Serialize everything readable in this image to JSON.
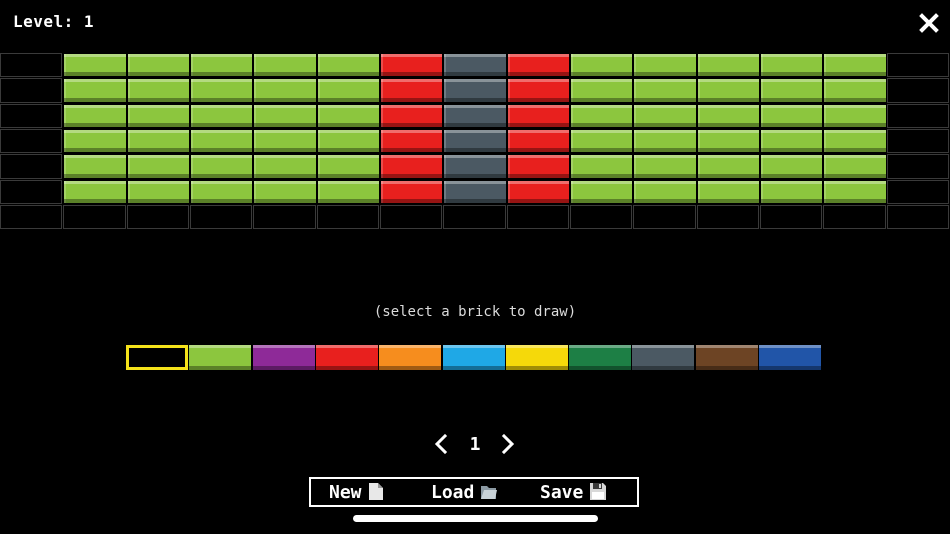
{
  "header": {
    "level_label": "Level: 1"
  },
  "grid": {
    "columns": 15,
    "rows": 7,
    "bricks": [
      [
        "empty",
        "green",
        "green",
        "green",
        "green",
        "green",
        "red",
        "gray",
        "red",
        "green",
        "green",
        "green",
        "green",
        "green",
        "empty"
      ],
      [
        "empty",
        "green",
        "green",
        "green",
        "green",
        "green",
        "red",
        "gray",
        "red",
        "green",
        "green",
        "green",
        "green",
        "green",
        "empty"
      ],
      [
        "empty",
        "green",
        "green",
        "green",
        "green",
        "green",
        "red",
        "gray",
        "red",
        "green",
        "green",
        "green",
        "green",
        "green",
        "empty"
      ],
      [
        "empty",
        "green",
        "green",
        "green",
        "green",
        "green",
        "red",
        "gray",
        "red",
        "green",
        "green",
        "green",
        "green",
        "green",
        "empty"
      ],
      [
        "empty",
        "green",
        "green",
        "green",
        "green",
        "green",
        "red",
        "gray",
        "red",
        "green",
        "green",
        "green",
        "green",
        "green",
        "empty"
      ],
      [
        "empty",
        "green",
        "green",
        "green",
        "green",
        "green",
        "red",
        "gray",
        "red",
        "green",
        "green",
        "green",
        "green",
        "green",
        "empty"
      ],
      [
        "empty",
        "empty",
        "empty",
        "empty",
        "empty",
        "empty",
        "empty",
        "empty",
        "empty",
        "empty",
        "empty",
        "empty",
        "empty",
        "empty",
        "empty"
      ]
    ]
  },
  "colors": {
    "green": "#8cc63e",
    "red": "#e8201e",
    "gray": "#4b5963",
    "purple": "#8e2a98",
    "orange": "#f68d1e",
    "cyan": "#1fa8e6",
    "yellow": "#f5d90a",
    "darkgreen": "#1d7f45",
    "brown": "#6d4424",
    "blue": "#2155a8",
    "selection": "#f5e21a"
  },
  "hint": "(select a brick to draw)",
  "palette": {
    "selected_index": 0,
    "items": [
      "empty",
      "green",
      "purple",
      "red",
      "orange",
      "cyan",
      "yellow",
      "darkgreen",
      "gray",
      "brown",
      "blue"
    ]
  },
  "pager": {
    "page": "1"
  },
  "toolbar": {
    "new_label": "New",
    "load_label": "Load",
    "save_label": "Save"
  }
}
